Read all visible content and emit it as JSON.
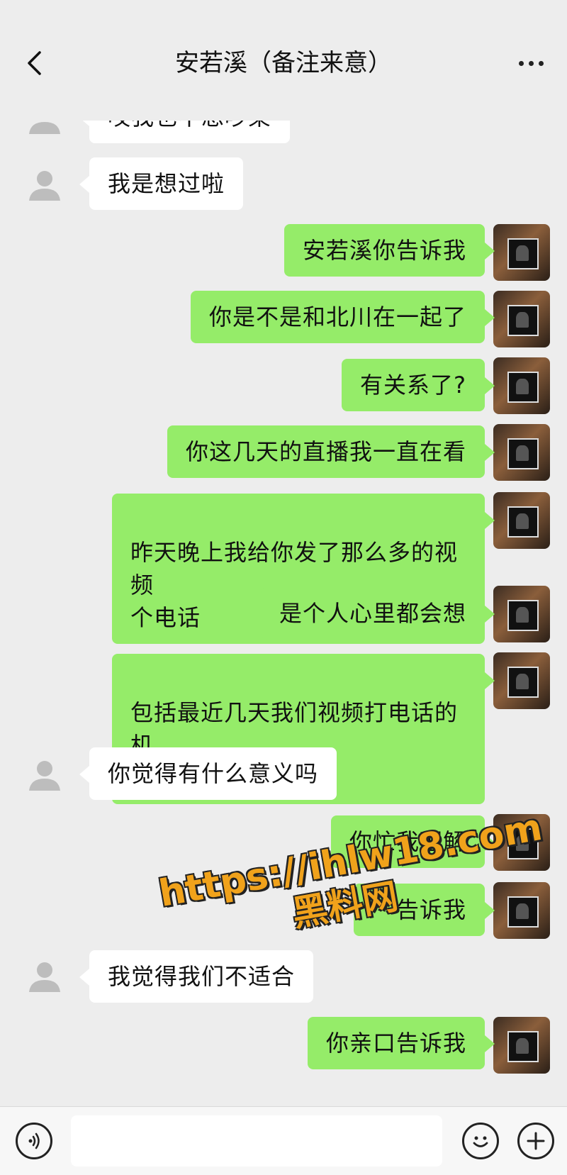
{
  "header": {
    "title": "安若溪（备注来意）",
    "back_icon": "chevron-left-icon",
    "more_icon": "more-dots-icon"
  },
  "messages": [
    {
      "side": "left",
      "text": "哎我也不想吵架"
    },
    {
      "side": "left",
      "text": "我是想过啦"
    },
    {
      "side": "right",
      "text": "安若溪你告诉我"
    },
    {
      "side": "right",
      "text": "你是不是和北川在一起了"
    },
    {
      "side": "right",
      "text": "有关系了?"
    },
    {
      "side": "right",
      "text": "你这几天的直播我一直在看"
    },
    {
      "side": "right",
      "text": "昨天晚上我给你发了那么多的视频\n个电话"
    },
    {
      "side": "right",
      "text": "是个人心里都会想"
    },
    {
      "side": "right",
      "text": "包括最近几天我们视频打电话的机\n会都没有"
    },
    {
      "side": "left",
      "text": "你觉得有什么意义吗"
    },
    {
      "side": "right",
      "text": "你忙我理解"
    },
    {
      "side": "right",
      "text": "告诉我"
    },
    {
      "side": "left",
      "text": "我觉得我们不适合"
    },
    {
      "side": "right",
      "text": "你亲口告诉我"
    }
  ],
  "watermark": {
    "url": "https://ihlw18.com",
    "name": "黑料网"
  },
  "input_bar": {
    "voice_icon": "voice-icon",
    "emoji_icon": "emoji-icon",
    "plus_icon": "plus-icon",
    "placeholder": ""
  },
  "colors": {
    "background": "#ededed",
    "sent_bubble": "#95ec69",
    "received_bubble": "#ffffff",
    "watermark": "#f0a21b"
  }
}
